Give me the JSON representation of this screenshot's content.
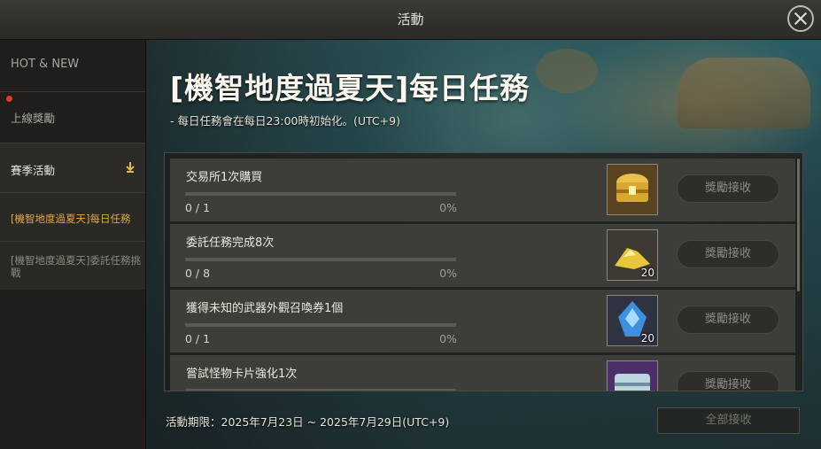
{
  "window": {
    "title": "活動"
  },
  "sidebar": {
    "items": [
      {
        "label": "HOT & NEW"
      },
      {
        "label": "上線獎勵"
      },
      {
        "label": "賽季活動"
      }
    ],
    "sub_items": [
      {
        "label": "[機智地度過夏天]每日任務"
      },
      {
        "label": "[機智地度過夏天]委託任務挑戰"
      }
    ]
  },
  "event": {
    "title": "[機智地度過夏天]每日任務",
    "subtitle": "- 每日任務會在每日23:00時初始化。(UTC+9)"
  },
  "quests": [
    {
      "name": "交易所1次購買",
      "count": "0 / 1",
      "percent": "0%",
      "progress": 0,
      "reward_icon": "treasure-chest-icon",
      "reward_qty": "",
      "button": "獎勵接收"
    },
    {
      "name": "委託任務完成8次",
      "count": "0 / 8",
      "percent": "0%",
      "progress": 0,
      "reward_icon": "gold-pile-icon",
      "reward_qty": "20",
      "button": "獎勵接收"
    },
    {
      "name": "獲得未知的武器外觀召喚券1個",
      "count": "0 / 1",
      "percent": "0%",
      "progress": 0,
      "reward_icon": "blue-crystal-icon",
      "reward_qty": "20",
      "button": "獎勵接收"
    },
    {
      "name": "嘗試怪物卡片強化1次",
      "count": "",
      "percent": "",
      "progress": 0,
      "reward_icon": "silver-chest-icon",
      "reward_qty": "",
      "button": "獎勵接收"
    }
  ],
  "footer": {
    "period": "活動期限：2025年7月23日 ~ 2025年7月29日(UTC+9)",
    "claim_all": "全部接收"
  },
  "colors": {
    "accent": "#e0a93a",
    "notification": "#e23a2b"
  }
}
